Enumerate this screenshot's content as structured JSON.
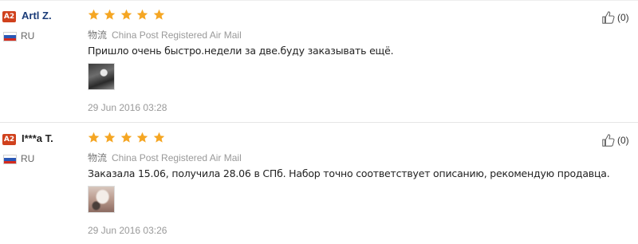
{
  "colors": {
    "level_badge": "#d0411d",
    "star": "#f5a623",
    "link_name": "#1a3b78",
    "muted_text": "#999999"
  },
  "reviews": [
    {
      "level": "A2",
      "user_name": "Artl        Z.",
      "country": "RU",
      "rating": 5,
      "shipping_label": "物流",
      "shipping_method": "China Post Registered Air Mail",
      "text": "Пришло очень быстро.недели за две.буду заказывать ещё.",
      "date": "29 Jun 2016 03:28",
      "useful_count": "(0)",
      "photo_icon": "product-photo-thumbnail"
    },
    {
      "level": "A2",
      "user_name": "I***a T.",
      "country": "RU",
      "rating": 5,
      "shipping_label": "物流",
      "shipping_method": "China Post Registered Air Mail",
      "text": "Заказала 15.06, получила 28.06 в СПб. Набор точно соответствует описанию, рекомендую продавца.",
      "date": "29 Jun 2016 03:26",
      "useful_count": "(0)",
      "photo_icon": "product-photo-thumbnail"
    }
  ]
}
